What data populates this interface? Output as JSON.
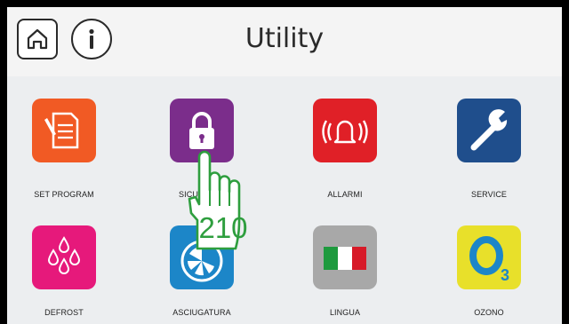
{
  "header": {
    "title": "Utility",
    "home_icon": "home-icon",
    "info_icon": "info-icon"
  },
  "tiles": [
    {
      "label": "SET PROGRAM",
      "icon": "document-edit-icon",
      "color": "#f15a24"
    },
    {
      "label": "SICUREZZA",
      "icon": "padlock-icon",
      "color": "#7b2d8b"
    },
    {
      "label": "ALLARMI",
      "icon": "alarm-bell-icon",
      "color": "#e02027"
    },
    {
      "label": "SERVICE",
      "icon": "wrench-icon",
      "color": "#1f4e8c"
    },
    {
      "label": "DEFROST",
      "icon": "water-drops-icon",
      "color": "#e6197b"
    },
    {
      "label": "ASCIUGATURA",
      "icon": "drying-icon",
      "color": "#1c86c8"
    },
    {
      "label": "LINGUA",
      "icon": "italian-flag-icon",
      "color": "#a8a8a8"
    },
    {
      "label": "OZONO",
      "icon": "ozone-o3-icon",
      "color": "#e8e02a"
    }
  ],
  "overlay": {
    "pointer_icon": "hand-pointer-icon",
    "number": "210",
    "color": "#2e9e3e"
  }
}
